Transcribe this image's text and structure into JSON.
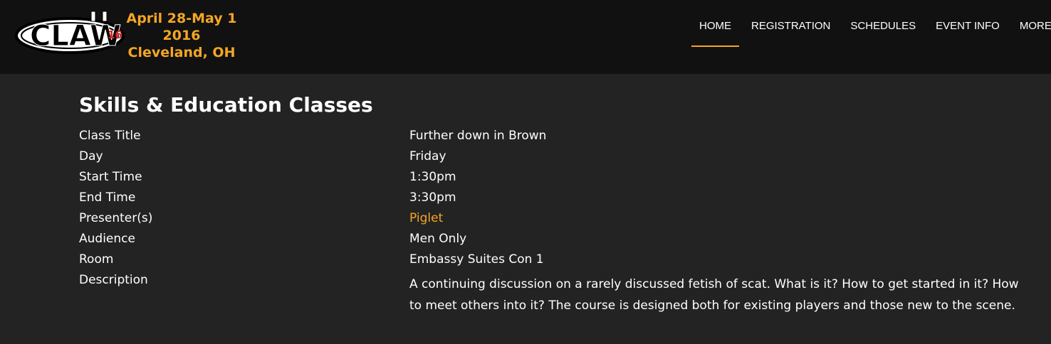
{
  "logo": {
    "mark_text": "CLAW",
    "badge": "16",
    "line1": "April 28-May 1",
    "line2": "2016",
    "line3": "Cleveland, OH"
  },
  "nav": {
    "items": [
      {
        "label": "HOME",
        "active": true
      },
      {
        "label": "REGISTRATION"
      },
      {
        "label": "SCHEDULES"
      },
      {
        "label": "EVENT INFO"
      },
      {
        "label": "MORE"
      }
    ]
  },
  "page": {
    "title": "Skills & Education Classes"
  },
  "details": {
    "class_title_label": "Class Title",
    "class_title": "Further down in Brown",
    "day_label": "Day",
    "day": "Friday",
    "start_label": "Start Time",
    "start": "1:30pm",
    "end_label": "End Time",
    "end": "3:30pm",
    "presenter_label": "Presenter(s)",
    "presenter": "Piglet",
    "audience_label": "Audience",
    "audience": "Men Only",
    "room_label": "Room",
    "room": "Embassy Suites Con 1",
    "description_label": "Description",
    "description": "A continuing discussion on a rarely discussed fetish of scat. What is it? How to get started in it? How to meet others into it? The course is designed both for existing players and those new to the scene."
  },
  "colors": {
    "accent": "#f5a623",
    "header_bg": "#111111",
    "page_bg": "#232323",
    "text": "#ffffff"
  }
}
